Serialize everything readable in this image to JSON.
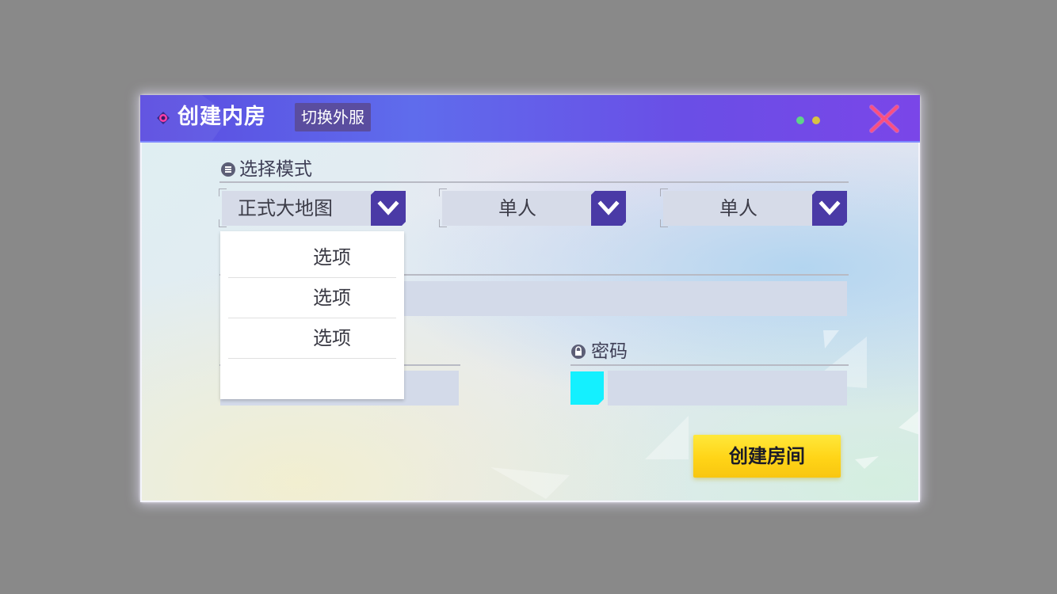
{
  "header": {
    "title": "创建内房",
    "switch_label": "切换外服"
  },
  "mode_section": {
    "title": "选择模式",
    "dropdowns": [
      {
        "value": "正式大地图"
      },
      {
        "value": "单人"
      },
      {
        "value": "单人"
      }
    ]
  },
  "password_section": {
    "title": "密码"
  },
  "dropdown_popup": {
    "options": [
      "选项",
      "选项",
      "选项"
    ]
  },
  "create_button": {
    "label": "创建房间"
  },
  "colors": {
    "title_bar": "#5f6cec",
    "arrow_box": "#4a3aa6",
    "create_button": "#ffd417",
    "cyan_box": "#14f0ff",
    "close_icon": "#ff4f7b"
  },
  "icons": [
    "record-icon",
    "close-icon",
    "list-icon",
    "lock-icon",
    "chevron-down-icon"
  ]
}
